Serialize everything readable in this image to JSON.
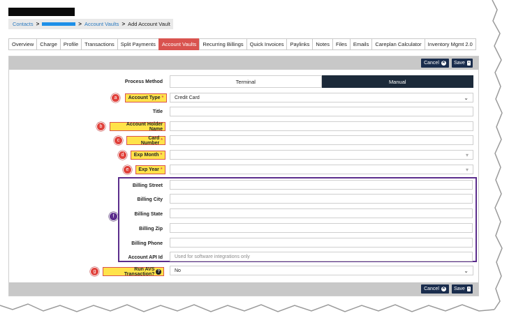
{
  "breadcrumb": {
    "contacts": "Contacts",
    "sep": ">",
    "account_vaults": "Account Vaults",
    "current": "Add Account Vault"
  },
  "tabs": [
    {
      "label": "Overview",
      "active": false
    },
    {
      "label": "Charge",
      "active": false
    },
    {
      "label": "Profile",
      "active": false
    },
    {
      "label": "Transactions",
      "active": false
    },
    {
      "label": "Split Payments",
      "active": false
    },
    {
      "label": "Account Vaults",
      "active": true
    },
    {
      "label": "Recurring Billings",
      "active": false
    },
    {
      "label": "Quick Invoices",
      "active": false
    },
    {
      "label": "Paylinks",
      "active": false
    },
    {
      "label": "Notes",
      "active": false
    },
    {
      "label": "Files",
      "active": false
    },
    {
      "label": "Emails",
      "active": false
    },
    {
      "label": "Careplan Calculator",
      "active": false
    },
    {
      "label": "Inventory Mgmt 2.0",
      "active": false
    }
  ],
  "toolbar": {
    "cancel_label": "Cancel",
    "save_label": "Save"
  },
  "form": {
    "process_method": {
      "label": "Process Method",
      "options": [
        "Terminal",
        "Manual"
      ],
      "selected": "Manual"
    },
    "account_type": {
      "label": "Account Type",
      "required": "*",
      "value": "Credit Card"
    },
    "title": {
      "label": "Title",
      "value": ""
    },
    "account_holder_name": {
      "label": "Account Holder Name",
      "value": ""
    },
    "card_number": {
      "label": "Card Number",
      "required": "*",
      "value": ""
    },
    "exp_month": {
      "label": "Exp Month",
      "required": "*",
      "value": ""
    },
    "exp_year": {
      "label": "Exp Year",
      "required": "*",
      "value": ""
    },
    "billing_street": {
      "label": "Billing Street",
      "value": ""
    },
    "billing_city": {
      "label": "Billing City",
      "value": ""
    },
    "billing_state": {
      "label": "Billing State",
      "value": ""
    },
    "billing_zip": {
      "label": "Billing Zip",
      "value": ""
    },
    "billing_phone": {
      "label": "Billing Phone",
      "value": ""
    },
    "account_api_id": {
      "label": "Account API Id",
      "placeholder": "Used for software integrations only"
    },
    "run_avs": {
      "label": "Run AVS Transaction?",
      "value": "No"
    }
  },
  "markers": [
    "a",
    "b",
    "c",
    "d",
    "e",
    "f",
    "g"
  ],
  "icons": {
    "cancel": "circle-x-icon",
    "save": "floppy-disk-icon",
    "dropdown": "chevron-down-icon",
    "help": "question-circle-icon"
  },
  "colors": {
    "active_tab": "#d9534f",
    "toolbar_button": "#1a2d4d",
    "highlight": "#ffe34a",
    "marker_red": "#e0413b",
    "marker_purple": "#5b2d8c",
    "link": "#2a7ac0"
  }
}
